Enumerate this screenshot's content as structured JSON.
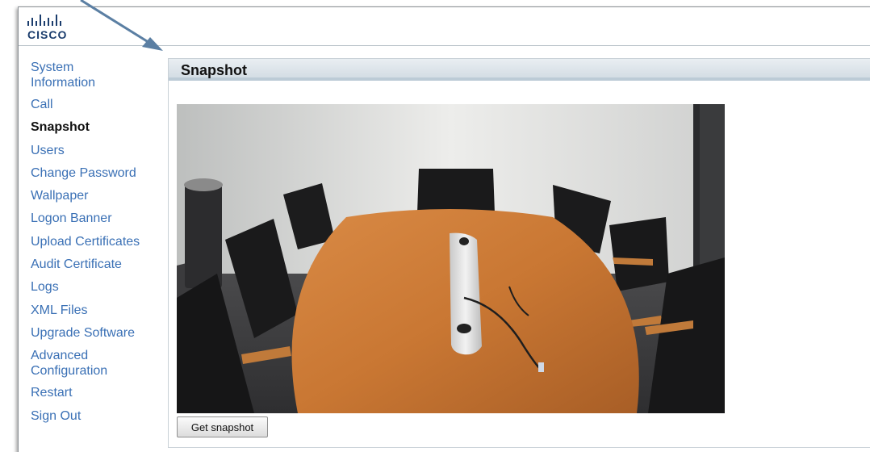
{
  "header": {
    "logo": {
      "icon": "cisco-logo",
      "text": "CISCO"
    }
  },
  "sidebar": {
    "items": [
      {
        "label": "System Information",
        "active": false
      },
      {
        "label": "Call",
        "active": false
      },
      {
        "label": "Snapshot",
        "active": true
      },
      {
        "label": "Users",
        "active": false
      },
      {
        "label": "Change Password",
        "active": false
      },
      {
        "label": "Wallpaper",
        "active": false
      },
      {
        "label": "Logon Banner",
        "active": false
      },
      {
        "label": "Upload Certificates",
        "active": false
      },
      {
        "label": "Audit Certificate",
        "active": false
      },
      {
        "label": "Logs",
        "active": false
      },
      {
        "label": "XML Files",
        "active": false
      },
      {
        "label": "Upgrade Software",
        "active": false
      },
      {
        "label": "Advanced Configuration",
        "active": false
      },
      {
        "label": "Restart",
        "active": false
      },
      {
        "label": "Sign Out",
        "active": false
      }
    ]
  },
  "main": {
    "section_title": "Snapshot",
    "snapshot_image": "conference-room-photo",
    "get_snapshot_label": "Get snapshot"
  },
  "colors": {
    "link": "#3a70b5",
    "title_bar": "#d4dde4",
    "annotation_arrow": "#5b7fa3"
  }
}
